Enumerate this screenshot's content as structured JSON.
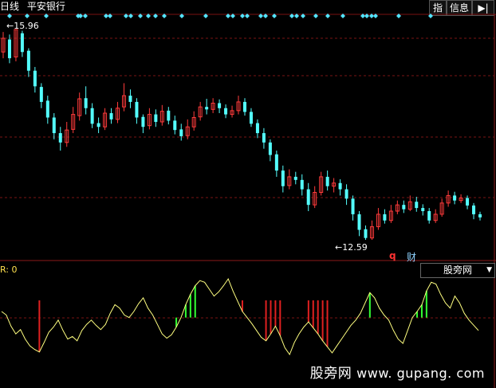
{
  "header": {
    "period": "日线",
    "stock_name": "平安银行"
  },
  "toolbar": {
    "index_label": "指",
    "info_label": "信息",
    "nav_icon": "arrow-right-icon"
  },
  "price_chart": {
    "high_label": "15.96",
    "low_label": "12.59",
    "q_marker": "q",
    "finance_marker": "财",
    "candles": [
      [
        15.6,
        15.82,
        15.92,
        15.5
      ],
      [
        15.8,
        15.5,
        15.88,
        15.42
      ],
      [
        15.52,
        15.96,
        15.96,
        15.45
      ],
      [
        15.9,
        15.6,
        15.94,
        15.52
      ],
      [
        15.62,
        15.3,
        15.66,
        15.2
      ],
      [
        15.3,
        15.05,
        15.36,
        14.95
      ],
      [
        15.04,
        14.8,
        15.1,
        14.7
      ],
      [
        14.82,
        14.55,
        14.9,
        14.45
      ],
      [
        14.55,
        14.3,
        14.62,
        14.2
      ],
      [
        14.3,
        14.15,
        14.4,
        14.02
      ],
      [
        14.15,
        14.35,
        14.48,
        14.08
      ],
      [
        14.36,
        14.6,
        14.72,
        14.3
      ],
      [
        14.58,
        14.85,
        14.95,
        14.5
      ],
      [
        14.86,
        14.7,
        15.05,
        14.6
      ],
      [
        14.7,
        14.45,
        14.78,
        14.38
      ],
      [
        14.46,
        14.4,
        14.55,
        14.3
      ],
      [
        14.4,
        14.62,
        14.7,
        14.35
      ],
      [
        14.62,
        14.52,
        14.7,
        14.45
      ],
      [
        14.52,
        14.7,
        14.8,
        14.46
      ],
      [
        14.72,
        14.9,
        15.1,
        14.65
      ],
      [
        14.9,
        14.8,
        15.0,
        14.7
      ],
      [
        14.8,
        14.55,
        14.86,
        14.45
      ],
      [
        14.56,
        14.4,
        14.6,
        14.3
      ],
      [
        14.42,
        14.6,
        14.7,
        14.36
      ],
      [
        14.6,
        14.48,
        14.68,
        14.4
      ],
      [
        14.48,
        14.65,
        14.75,
        14.42
      ],
      [
        14.66,
        14.5,
        14.72,
        14.44
      ],
      [
        14.5,
        14.35,
        14.58,
        14.28
      ],
      [
        14.36,
        14.25,
        14.45,
        14.18
      ],
      [
        14.26,
        14.4,
        14.52,
        14.2
      ],
      [
        14.4,
        14.55,
        14.65,
        14.34
      ],
      [
        14.56,
        14.72,
        14.8,
        14.5
      ],
      [
        14.72,
        14.68,
        14.85,
        14.6
      ],
      [
        14.68,
        14.78,
        14.86,
        14.62
      ],
      [
        14.78,
        14.7,
        14.84,
        14.62
      ],
      [
        14.7,
        14.6,
        14.76,
        14.54
      ],
      [
        14.6,
        14.66,
        14.74,
        14.55
      ],
      [
        14.66,
        14.8,
        14.9,
        14.6
      ],
      [
        14.8,
        14.64,
        14.86,
        14.58
      ],
      [
        14.64,
        14.45,
        14.7,
        14.4
      ],
      [
        14.46,
        14.3,
        14.52,
        14.22
      ],
      [
        14.3,
        14.15,
        14.38,
        14.05
      ],
      [
        14.15,
        13.95,
        14.2,
        13.85
      ],
      [
        13.96,
        13.7,
        14.02,
        13.6
      ],
      [
        13.7,
        13.45,
        13.78,
        13.35
      ],
      [
        13.46,
        13.6,
        13.72,
        13.4
      ],
      [
        13.6,
        13.55,
        13.68,
        13.48
      ],
      [
        13.55,
        13.4,
        13.64,
        13.3
      ],
      [
        13.4,
        13.15,
        13.5,
        13.05
      ],
      [
        13.15,
        13.35,
        13.45,
        13.1
      ],
      [
        13.35,
        13.6,
        13.68,
        13.3
      ],
      [
        13.6,
        13.45,
        13.7,
        13.38
      ],
      [
        13.45,
        13.5,
        13.58,
        13.35
      ],
      [
        13.5,
        13.4,
        13.56,
        13.3
      ],
      [
        13.4,
        13.25,
        13.48,
        13.15
      ],
      [
        13.25,
        13.0,
        13.3,
        12.9
      ],
      [
        13.0,
        12.75,
        13.05,
        12.65
      ],
      [
        12.76,
        12.62,
        12.82,
        12.59
      ],
      [
        12.62,
        12.8,
        12.9,
        12.59
      ],
      [
        12.8,
        13.0,
        13.1,
        12.75
      ],
      [
        13.0,
        12.9,
        13.08,
        12.85
      ],
      [
        12.9,
        13.05,
        13.15,
        12.86
      ],
      [
        13.05,
        13.15,
        13.22,
        13.0
      ],
      [
        13.15,
        13.08,
        13.22,
        13.02
      ],
      [
        13.08,
        13.2,
        13.3,
        13.05
      ],
      [
        13.2,
        13.1,
        13.28,
        13.04
      ],
      [
        13.1,
        13.05,
        13.16,
        12.98
      ],
      [
        13.05,
        12.9,
        13.1,
        12.85
      ],
      [
        12.9,
        13.0,
        13.08,
        12.86
      ],
      [
        13.0,
        13.18,
        13.25,
        12.96
      ],
      [
        13.18,
        13.3,
        13.38,
        13.12
      ],
      [
        13.3,
        13.22,
        13.36,
        13.16
      ],
      [
        13.22,
        13.26,
        13.32,
        13.18
      ],
      [
        13.26,
        13.14,
        13.3,
        13.08
      ],
      [
        13.14,
        13.0,
        13.18,
        12.92
      ],
      [
        13.0,
        12.95,
        13.04,
        12.9
      ]
    ],
    "diamond_positions": [
      12,
      34,
      58,
      98,
      101,
      107,
      133,
      138,
      158,
      164,
      176,
      186,
      195,
      206,
      228,
      258,
      286,
      292,
      304,
      310,
      327,
      333,
      344,
      366,
      372,
      380,
      396,
      411,
      430,
      455,
      460,
      466,
      471,
      500,
      540
    ]
  },
  "indicator": {
    "name_label": "R: 0",
    "combo_label": "股旁网",
    "series": [
      0.62,
      0.58,
      0.45,
      0.36,
      0.41,
      0.3,
      0.22,
      0.18,
      0.15,
      0.26,
      0.38,
      0.44,
      0.52,
      0.4,
      0.3,
      0.33,
      0.28,
      0.4,
      0.47,
      0.52,
      0.46,
      0.41,
      0.47,
      0.6,
      0.7,
      0.66,
      0.58,
      0.55,
      0.62,
      0.71,
      0.78,
      0.66,
      0.58,
      0.47,
      0.36,
      0.31,
      0.35,
      0.44,
      0.55,
      0.7,
      0.82,
      0.92,
      0.98,
      0.96,
      0.88,
      0.8,
      0.85,
      0.92,
      1.0,
      0.86,
      0.74,
      0.62,
      0.55,
      0.48,
      0.4,
      0.32,
      0.28,
      0.36,
      0.45,
      0.34,
      0.2,
      0.12,
      0.26,
      0.36,
      0.44,
      0.5,
      0.43,
      0.36,
      0.28,
      0.21,
      0.14,
      0.22,
      0.3,
      0.38,
      0.46,
      0.52,
      0.6,
      0.72,
      0.84,
      0.78,
      0.66,
      0.58,
      0.52,
      0.4,
      0.3,
      0.25,
      0.4,
      0.55,
      0.62,
      0.7,
      0.86,
      0.96,
      0.94,
      0.82,
      0.72,
      0.66,
      0.8,
      0.72,
      0.6,
      0.52,
      0.46,
      0.4
    ],
    "green_bars": [
      37,
      38,
      39,
      40,
      41,
      78,
      87,
      88,
      89,
      90
    ],
    "red_bars": [
      8,
      51,
      56,
      57,
      58,
      59,
      65,
      66,
      67,
      68,
      69
    ]
  },
  "watermark": {
    "cn": "股旁网",
    "url": "www. gupang. com"
  }
}
